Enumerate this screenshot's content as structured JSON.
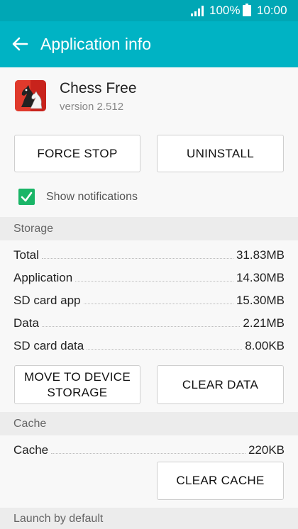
{
  "status_bar": {
    "battery_percent": "100%",
    "time": "10:00"
  },
  "app_bar": {
    "title": "Application info"
  },
  "app": {
    "name": "Chess Free",
    "version": "version 2.512"
  },
  "buttons": {
    "force_stop": "FORCE STOP",
    "uninstall": "UNINSTALL",
    "move_to_device_storage": "MOVE TO DEVICE STORAGE",
    "clear_data": "CLEAR DATA",
    "clear_cache": "CLEAR CACHE"
  },
  "notifications": {
    "label": "Show notifications",
    "checked": true
  },
  "storage": {
    "header": "Storage",
    "rows": [
      {
        "label": "Total",
        "value": "31.83MB"
      },
      {
        "label": "Application",
        "value": "14.30MB"
      },
      {
        "label": "SD card app",
        "value": "15.30MB"
      },
      {
        "label": "Data",
        "value": "2.21MB"
      },
      {
        "label": "SD card data",
        "value": "8.00KB"
      }
    ]
  },
  "cache": {
    "header": "Cache",
    "rows": [
      {
        "label": "Cache",
        "value": "220KB"
      }
    ]
  },
  "launch_default": {
    "header": "Launch by default"
  },
  "icons": {
    "signal": "signal-icon",
    "battery": "battery-icon",
    "back": "back-arrow-icon",
    "app": "chess-knight-icon",
    "check": "checkmark-icon"
  },
  "colors": {
    "status_bar": "#00a7b5",
    "app_bar": "#00b3c4",
    "checkbox": "#1ab567",
    "section_header_bg": "#ececec",
    "background": "#f8f8f8"
  }
}
